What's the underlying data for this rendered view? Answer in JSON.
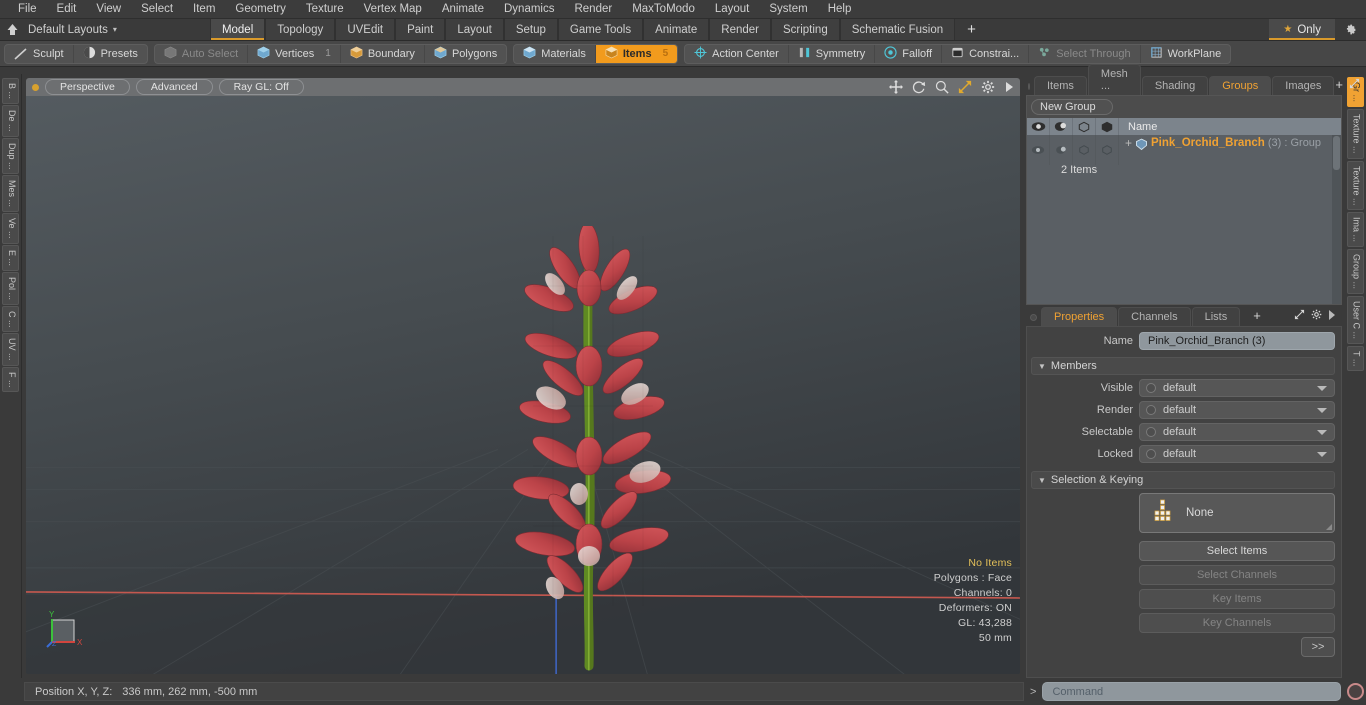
{
  "menu": {
    "items": [
      "File",
      "Edit",
      "View",
      "Select",
      "Item",
      "Geometry",
      "Texture",
      "Vertex Map",
      "Animate",
      "Dynamics",
      "Render",
      "MaxToModo",
      "Layout",
      "System",
      "Help"
    ]
  },
  "layout_row": {
    "home_icon": "home-icon",
    "layouts_label": "Default Layouts",
    "caret": "▾",
    "tabs": [
      {
        "label": "Model",
        "active": true
      },
      {
        "label": "Topology",
        "active": false
      },
      {
        "label": "UVEdit",
        "active": false
      },
      {
        "label": "Paint",
        "active": false
      },
      {
        "label": "Layout",
        "active": false
      },
      {
        "label": "Setup",
        "active": false
      },
      {
        "label": "Game Tools",
        "active": false
      },
      {
        "label": "Animate",
        "active": false
      },
      {
        "label": "Render",
        "active": false
      },
      {
        "label": "Scripting",
        "active": false
      },
      {
        "label": "Schematic Fusion",
        "active": false
      }
    ],
    "add_tab": "+",
    "only_label": "Only",
    "star_icon": "star-icon",
    "gear_icon": "gear-icon"
  },
  "mode_toolbar": {
    "group1": [
      {
        "label": "Sculpt",
        "icon": "sculpt-icon",
        "state": "normal",
        "num": ""
      },
      {
        "label": "Presets",
        "icon": "presets-icon",
        "state": "normal",
        "num": ""
      }
    ],
    "group2": [
      {
        "label": "Auto Select",
        "icon": "cube-gray-icon",
        "state": "dim",
        "num": ""
      },
      {
        "label": "Vertices",
        "icon": "cube-blue-icon",
        "state": "normal",
        "num": "1"
      },
      {
        "label": "Boundary",
        "icon": "cube-orange-icon",
        "state": "normal",
        "num": ""
      },
      {
        "label": "Polygons",
        "icon": "cube-blue-icon",
        "state": "normal",
        "num": ""
      }
    ],
    "group3": [
      {
        "label": "Materials",
        "icon": "cube-blue-icon",
        "state": "normal",
        "num": ""
      },
      {
        "label": "Items",
        "icon": "cube-orange-icon",
        "state": "on",
        "num": "5"
      }
    ],
    "group4": [
      {
        "label": "Action Center",
        "icon": "target-icon",
        "state": "normal",
        "num": ""
      },
      {
        "label": "Symmetry",
        "icon": "symmetry-icon",
        "state": "normal",
        "num": ""
      },
      {
        "label": "Falloff",
        "icon": "falloff-icon",
        "state": "normal",
        "num": ""
      },
      {
        "label": "Constrai...",
        "icon": "constraint-icon",
        "state": "normal",
        "num": ""
      },
      {
        "label": "Select Through",
        "icon": "select-through-icon",
        "state": "dim",
        "num": ""
      },
      {
        "label": "WorkPlane",
        "icon": "workplane-icon",
        "state": "normal",
        "num": ""
      }
    ]
  },
  "left_strip": {
    "tabs": [
      "B ...",
      "De ...",
      "Dup ...",
      "Mes ...",
      "Ve ...",
      "E ...",
      "Pol ...",
      "C ...",
      "UV ...",
      "F ..."
    ]
  },
  "viewport": {
    "dot_icon": "record-dot-icon",
    "pills": [
      "Perspective",
      "Advanced",
      "Ray GL: Off"
    ],
    "icons": [
      "move-icon",
      "rotate-icon",
      "zoom-icon",
      "fit-icon",
      "gear-icon",
      "arrow-right-icon"
    ],
    "stats": {
      "no_items": "No Items",
      "polygons": "Polygons : Face",
      "channels": "Channels: 0",
      "deformers": "Deformers: ON",
      "gl": "GL: 43,288",
      "scale": "50 mm"
    },
    "axis": {
      "x": "X",
      "y": "Y",
      "z": "Z"
    }
  },
  "right_panel": {
    "tabs": [
      {
        "label": "Items",
        "active": false
      },
      {
        "label": "Mesh ...",
        "active": false
      },
      {
        "label": "Shading",
        "active": false
      },
      {
        "label": "Groups",
        "active": true
      },
      {
        "label": "Images",
        "active": false
      }
    ],
    "add_tab": "+",
    "expand_icon": "expand-icon",
    "more_icon": "arrow-right-icon",
    "groups": {
      "new_group_label": "New Group",
      "columns": [
        "eye-icon",
        "render-icon",
        "wireframe-icon",
        "shaded-icon",
        "Name"
      ],
      "rows": [
        {
          "expander": "+",
          "icon": "group-shield-icon",
          "name": "Pink_Orchid_Branch",
          "count": "(3)",
          "type": ": Group",
          "subtitle": "2 Items"
        }
      ]
    },
    "properties": {
      "tabs": [
        {
          "label": "Properties",
          "active": true
        },
        {
          "label": "Channels",
          "active": false
        },
        {
          "label": "Lists",
          "active": false
        }
      ],
      "add_tab": "+",
      "name_label": "Name",
      "name_value": "Pink_Orchid_Branch (3)",
      "members_section": "Members",
      "members": [
        {
          "label": "Visible",
          "value": "default"
        },
        {
          "label": "Render",
          "value": "default"
        },
        {
          "label": "Selectable",
          "value": "default"
        },
        {
          "label": "Locked",
          "value": "default"
        }
      ],
      "selection_section": "Selection & Keying",
      "preset_box": {
        "icon": "matrix-icon",
        "label": "None"
      },
      "buttons": [
        {
          "label": "Select Items",
          "enabled": true
        },
        {
          "label": "Select Channels",
          "enabled": false
        },
        {
          "label": "Key Items",
          "enabled": false
        },
        {
          "label": "Key Channels",
          "enabled": false
        }
      ],
      "ff_button": ">>"
    }
  },
  "right_strip": {
    "tabs": [
      {
        "label": "Gr ...",
        "active": true
      },
      {
        "label": "Texture ...",
        "active": false
      },
      {
        "label": "Texture ...",
        "active": false
      },
      {
        "label": "Ima ...",
        "active": false
      },
      {
        "label": "Group ...",
        "active": false
      },
      {
        "label": "User C ...",
        "active": false
      },
      {
        "label": "T ...",
        "active": false
      }
    ]
  },
  "bottom": {
    "status_label": "Position X, Y, Z:",
    "status_value": "336 mm, 262 mm, -500 mm",
    "command_arrow": ">",
    "command_placeholder": "Command",
    "record_icon": "record-icon"
  },
  "colors": {
    "accent": "#f0a233",
    "tab_underline": "#d99a2b",
    "panel_bg": "#3a3a3a",
    "field_bg": "#8f979d",
    "stem_green": "#7aa02e",
    "petal_red": "#c0474b"
  }
}
